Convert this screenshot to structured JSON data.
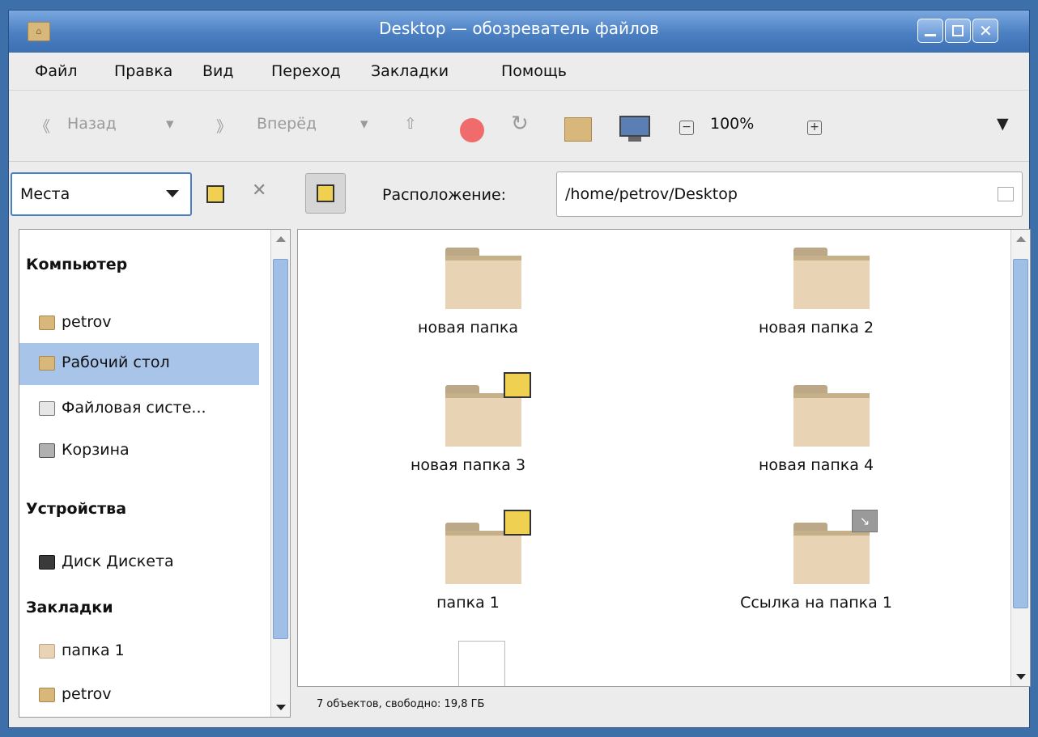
{
  "window": {
    "title": "Desktop — обозреватель файлов"
  },
  "menubar": {
    "items": [
      "Файл",
      "Правка",
      "Вид",
      "Переход",
      "Закладки",
      "Помощь"
    ]
  },
  "toolbar": {
    "back_label": "Назад",
    "forward_label": "Вперёд",
    "zoom_level": "100%"
  },
  "pathbar": {
    "places_label": "Места",
    "location_label": "Расположение:",
    "location_value": "/home/petrov/Desktop"
  },
  "sidebar": {
    "sections": [
      {
        "title": "Компьютер",
        "items": [
          {
            "label": "petrov",
            "icon": "home-folder-icon",
            "selected": false
          },
          {
            "label": "Рабочий стол",
            "icon": "desktop-folder-icon",
            "selected": true
          },
          {
            "label": "Файловая систе...",
            "icon": "filesystem-icon",
            "selected": false
          },
          {
            "label": "Корзина",
            "icon": "trash-icon",
            "selected": false
          }
        ]
      },
      {
        "title": "Устройства",
        "items": [
          {
            "label": "Диск Дискета",
            "icon": "floppy-icon",
            "selected": false
          }
        ]
      },
      {
        "title": "Закладки",
        "items": [
          {
            "label": "папка 1",
            "icon": "folder-icon",
            "selected": false
          },
          {
            "label": "petrov",
            "icon": "home-folder-icon",
            "selected": false
          }
        ]
      }
    ]
  },
  "files": [
    {
      "name": "новая папка",
      "emblem": null
    },
    {
      "name": "новая папка 2",
      "emblem": null
    },
    {
      "name": "новая папка 3",
      "emblem": "edit"
    },
    {
      "name": "новая папка 4",
      "emblem": null
    },
    {
      "name": "папка 1",
      "emblem": "edit"
    },
    {
      "name": "Ссылка на папка 1",
      "emblem": "link"
    }
  ],
  "status": {
    "text": "7 объектов, свободно: 19,8 ГБ"
  },
  "colors": {
    "selection": "#a8c4e8",
    "titlebar": "#4a7fc2",
    "folder": "#e8d4b4"
  }
}
